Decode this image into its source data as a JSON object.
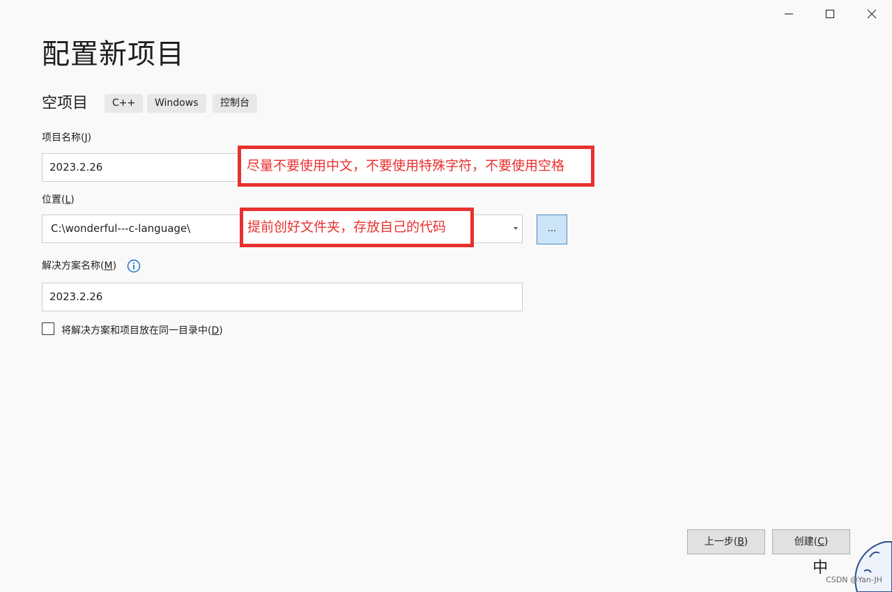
{
  "window": {
    "controls": [
      "minimize-icon",
      "maximize-icon",
      "close-icon"
    ]
  },
  "title": "配置新项目",
  "template": {
    "name": "空项目",
    "tags": [
      "C++",
      "Windows",
      "控制台"
    ]
  },
  "project_name": {
    "label": "项目名称(",
    "accesskey": "J",
    "label_end": ")",
    "value": "2023.2.26"
  },
  "location": {
    "label": "位置(",
    "accesskey": "L",
    "label_end": ")",
    "value": "C:\\wonderful---c-language\\",
    "browse_label": "..."
  },
  "solution_name": {
    "label": "解决方案名称(",
    "accesskey": "M",
    "label_end": ")",
    "value": "2023.2.26"
  },
  "same_dir": {
    "label": "将解决方案和项目放在同一目录中(",
    "accesskey": "D",
    "label_end": ")",
    "checked": false
  },
  "annotations": {
    "name_note": "尽量不要使用中文，不要使用特殊字符，不要使用空格",
    "location_note": "提前创好文件夹，存放自己的代码",
    "color": "#e8312f"
  },
  "footer": {
    "back_label": "上一步(",
    "back_key": "B",
    "back_end": ")",
    "create_label": "创建(",
    "create_key": "C",
    "create_end": ")"
  },
  "watermark": "CSDN @Yan-JH",
  "colors": {
    "accent_border": "#4a89c7",
    "accent_bg": "#cce4f7",
    "info_blue": "#1a73c8"
  }
}
